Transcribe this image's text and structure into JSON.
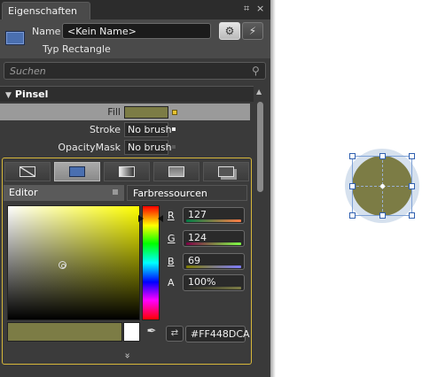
{
  "panel": {
    "tab_title": "Eigenschaften",
    "pin_glyph": "📌",
    "close_glyph": "×"
  },
  "header": {
    "name_label": "Name",
    "name_value": "<Kein Name>",
    "type_label": "Typ",
    "type_value": "Rectangle",
    "mode_buttons": [
      "properties-icon",
      "events-icon"
    ]
  },
  "search": {
    "placeholder": "Suchen"
  },
  "brush_section": {
    "title": "Pinsel",
    "rows": [
      {
        "label": "Fill",
        "value": ""
      },
      {
        "label": "Stroke",
        "value": "No brush"
      },
      {
        "label": "OpacityMask",
        "value": "No brush"
      }
    ]
  },
  "editor": {
    "brush_type_tabs": [
      "no-brush-icon",
      "solid-color-brush-icon",
      "gradient-brush-icon",
      "tile-brush-icon",
      "resource-brush-icon"
    ],
    "active_brush_tab": 1,
    "subtabs": [
      "Editor",
      "Farbressourcen"
    ],
    "channels": [
      {
        "label": "R",
        "value": "127"
      },
      {
        "label": "G",
        "value": "124"
      },
      {
        "label": "B",
        "value": "69"
      },
      {
        "label": "A",
        "value": "100%"
      }
    ],
    "hex": "#FF448DCA",
    "expand_glyph": "»"
  },
  "colors": {
    "selected_fill": "#7c7c45",
    "selection_accent": "#d7b73a",
    "selection_frame": "#3060b0"
  }
}
